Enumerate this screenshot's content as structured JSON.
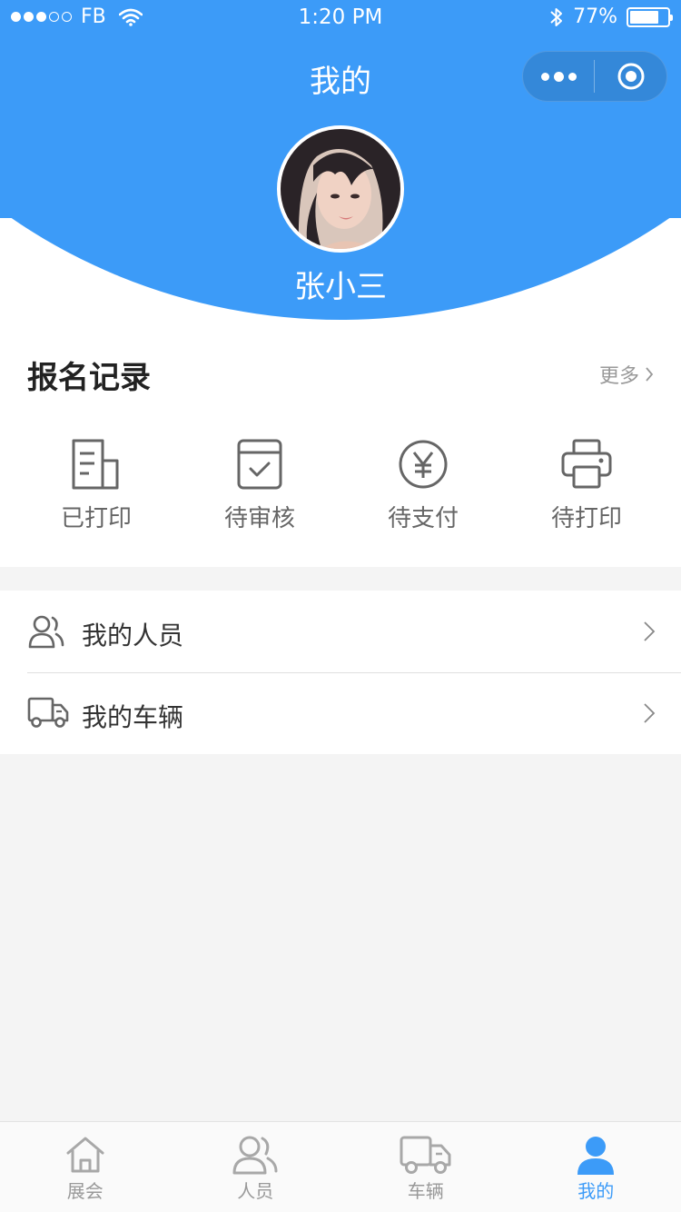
{
  "status_bar": {
    "carrier": "FB",
    "time": "1:20 PM",
    "battery": "77%",
    "battery_level": 0.77
  },
  "nav": {
    "title": "我的"
  },
  "profile": {
    "name": "张小三"
  },
  "records": {
    "title": "报名记录",
    "more_label": "更多",
    "items": [
      {
        "label": "已打印",
        "icon": "document-icon"
      },
      {
        "label": "待审核",
        "icon": "calendar-check-icon"
      },
      {
        "label": "待支付",
        "icon": "yen-icon"
      },
      {
        "label": "待打印",
        "icon": "printer-icon"
      }
    ]
  },
  "menu": {
    "items": [
      {
        "label": "我的人员",
        "icon": "people-icon"
      },
      {
        "label": "我的车辆",
        "icon": "truck-icon"
      }
    ]
  },
  "tabbar": {
    "items": [
      {
        "label": "展会",
        "icon": "home-icon"
      },
      {
        "label": "人员",
        "icon": "people-icon"
      },
      {
        "label": "车辆",
        "icon": "truck-icon"
      },
      {
        "label": "我的",
        "icon": "user-icon",
        "active": true
      }
    ]
  },
  "colors": {
    "primary": "#3c9bf8",
    "background": "#f4f4f4",
    "icon_gray": "#666666",
    "tab_gray": "#999999"
  }
}
